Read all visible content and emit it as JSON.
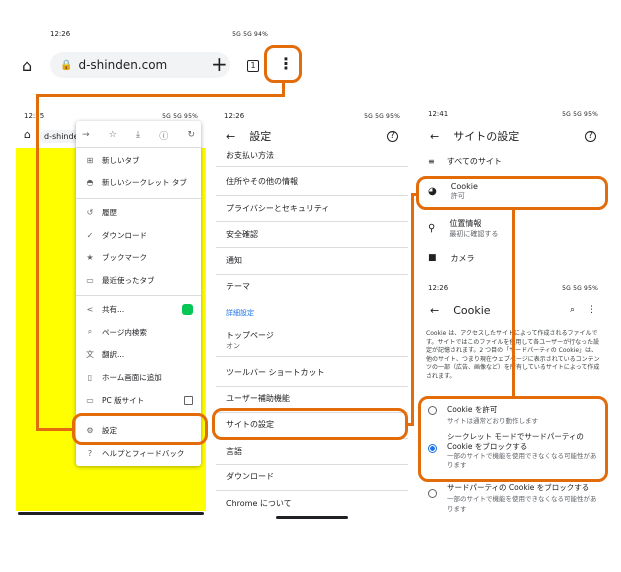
{
  "s1": {
    "time": "12:26",
    "status_right": "5G 5G 94%",
    "url": "d-shinden.com",
    "tab_count": "1"
  },
  "s2": {
    "time": "12:25",
    "status_right": "5G 5G 95%",
    "url_partial": "d-shinden",
    "menu": [
      {
        "icon": "new-tab",
        "label": "新しいタブ"
      },
      {
        "icon": "incognito",
        "label": "新しいシークレット タブ"
      },
      {
        "icon": "history",
        "label": "履歴"
      },
      {
        "icon": "download",
        "label": "ダウンロード"
      },
      {
        "icon": "bookmark",
        "label": "ブックマーク"
      },
      {
        "icon": "recent-tabs",
        "label": "最近使ったタブ"
      },
      {
        "icon": "share",
        "label": "共有..."
      },
      {
        "icon": "find",
        "label": "ページ内検索"
      },
      {
        "icon": "translate",
        "label": "翻訳..."
      },
      {
        "icon": "add-home",
        "label": "ホーム画面に追加"
      },
      {
        "icon": "desktop",
        "label": "PC 版サイト"
      },
      {
        "icon": "settings",
        "label": "設定"
      },
      {
        "icon": "help",
        "label": "ヘルプとフィードバック"
      }
    ]
  },
  "s3": {
    "time": "12:26",
    "status_right": "5G 5G 95%",
    "title": "設定",
    "items": [
      "お支払い方法",
      "住所やその他の情報",
      "プライバシーとセキュリティ",
      "安全確認",
      "通知",
      "テーマ"
    ],
    "section": "詳細設定",
    "items2": [
      {
        "label": "トップページ",
        "sub": "オン"
      },
      {
        "label": "ツールバー ショートカット",
        "sub": ""
      },
      {
        "label": "ユーザー補助機能",
        "sub": ""
      },
      {
        "label": "サイトの設定",
        "sub": ""
      },
      {
        "label": "言語",
        "sub": ""
      },
      {
        "label": "ダウンロード",
        "sub": ""
      },
      {
        "label": "Chrome について",
        "sub": ""
      }
    ]
  },
  "s4": {
    "time": "12:41",
    "status_right": "5G 5G 95%",
    "title": "サイトの設定",
    "all_sites": "すべてのサイト",
    "cookie_label": "Cookie",
    "cookie_sub": "許可",
    "location_label": "位置情報",
    "location_sub": "最初に確認する",
    "camera_label": "カメラ"
  },
  "s5": {
    "time": "12:26",
    "status_right": "5G 5G 95%",
    "title": "Cookie",
    "desc": "Cookie は、アクセスしたサイトによって作成されるファイルです。サイトではこのファイルを使用して各ユーザーが行なった設定が記憶されます。2 つ目の「サードパーティの Cookie」は、他のサイト、つまり現在ウェブページに表示されているコンテンツの一部（広告、画像など）を所有しているサイトによって作成されます。",
    "options": [
      {
        "label": "Cookie を許可",
        "sub": "サイトは通常どおり動作します"
      },
      {
        "label": "シークレット モードでサードパーティの Cookie をブロックする",
        "sub": "一部のサイトで機能を使用できなくなる可能性があります"
      },
      {
        "label": "サードパーティの Cookie をブロックする",
        "sub": "一部のサイトで機能を使用できなくなる可能性があります"
      }
    ]
  }
}
